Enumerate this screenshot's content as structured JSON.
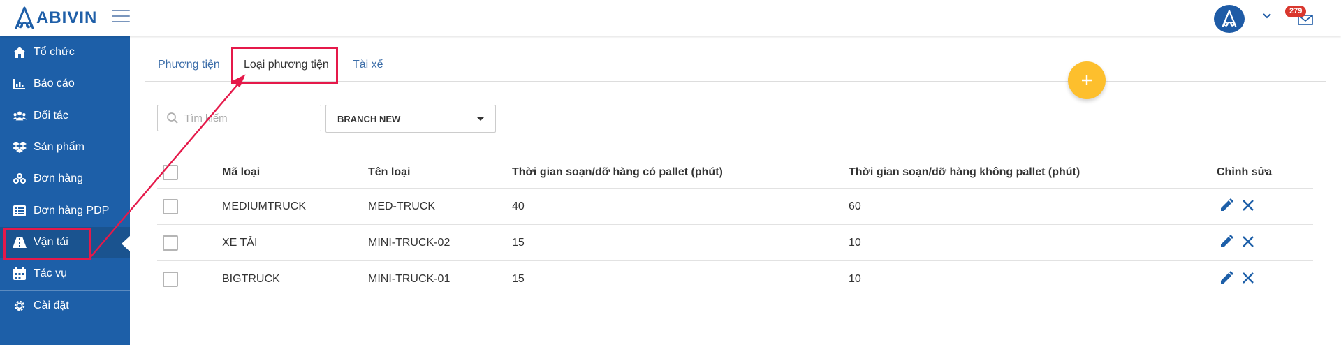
{
  "brand": {
    "name": "ABIVIN",
    "color": "#1f5fa8"
  },
  "header": {
    "notification_count": "279",
    "avatar_icon": "abivin-logo-icon",
    "mail_icon": "mail-icon"
  },
  "sidebar": {
    "color": "#1d5fa8",
    "items": [
      {
        "label": "Tổ chức",
        "icon": "home-icon"
      },
      {
        "label": "Báo cáo",
        "icon": "chart-icon"
      },
      {
        "label": "Đối tác",
        "icon": "users-icon"
      },
      {
        "label": "Sản phẩm",
        "icon": "dropbox-icon"
      },
      {
        "label": "Đơn hàng",
        "icon": "cubes-icon"
      },
      {
        "label": "Đơn hàng PDP",
        "icon": "list-icon"
      },
      {
        "label": "Vận tải",
        "icon": "road-icon",
        "active": true
      },
      {
        "label": "Tác vụ",
        "icon": "calendar-icon"
      },
      {
        "label": "Cài đặt",
        "icon": "gear-icon"
      }
    ]
  },
  "tabs": [
    {
      "label": "Phương tiện"
    },
    {
      "label": "Loại phương tiện",
      "active": true
    },
    {
      "label": "Tài xế"
    }
  ],
  "search": {
    "placeholder": "Tìm kiếm"
  },
  "branch_select": {
    "value": "BRANCH NEW"
  },
  "table": {
    "headers": [
      "Mã loại",
      "Tên loại",
      "Thời gian soạn/dỡ hàng có pallet (phút)",
      "Thời gian soạn/dỡ hàng không pallet (phút)",
      "Chỉnh sửa"
    ],
    "rows": [
      {
        "code": "MEDIUMTRUCK",
        "name": "MED-TRUCK",
        "pallet": "40",
        "no_pallet": "60"
      },
      {
        "code": "XE TẢI",
        "name": "MINI-TRUCK-02",
        "pallet": "15",
        "no_pallet": "10"
      },
      {
        "code": "BIGTRUCK",
        "name": "MINI-TRUCK-01",
        "pallet": "15",
        "no_pallet": "10"
      }
    ]
  },
  "colors": {
    "accent": "#3a6ca8",
    "fab": "#fdbf2d",
    "highlight": "#e5194a",
    "badge": "#d9372e"
  }
}
